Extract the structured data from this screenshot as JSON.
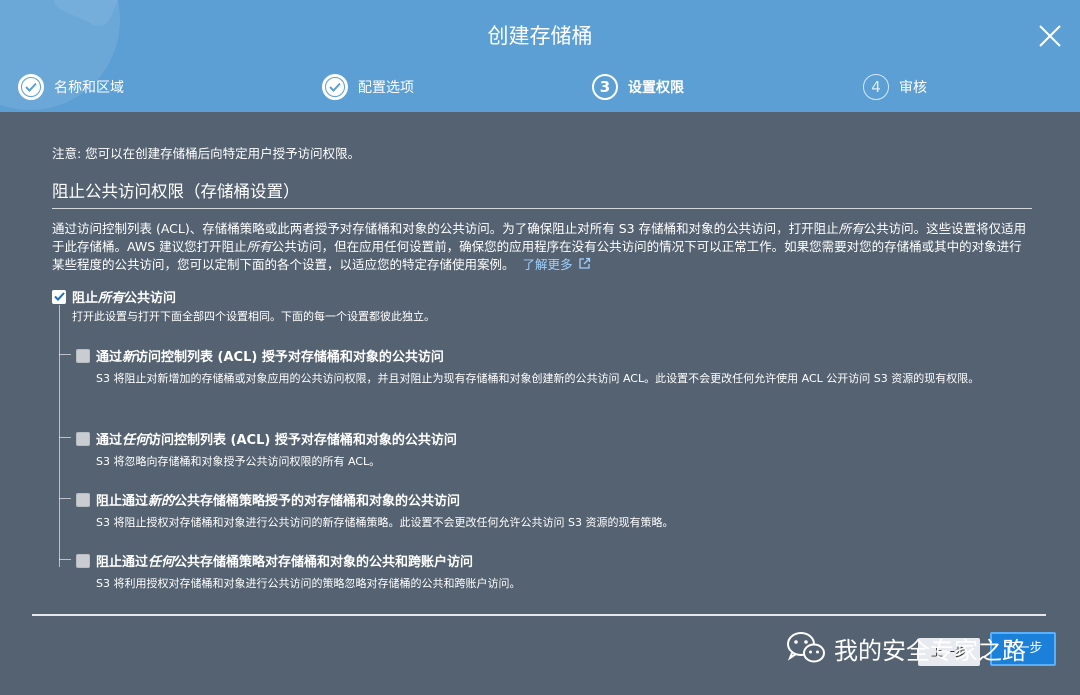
{
  "dialog": {
    "title": "创建存储桶",
    "close_icon": "close-icon"
  },
  "steps": [
    {
      "label": "名称和区域",
      "state": "done"
    },
    {
      "label": "配置选项",
      "state": "done"
    },
    {
      "number": "3",
      "label": "设置权限",
      "state": "current"
    },
    {
      "number": "4",
      "label": "审核",
      "state": "todo"
    }
  ],
  "notice": "注意: 您可以在创建存储桶后向特定用户授予访问权限。",
  "section": {
    "title": "阻止公共访问权限（存储桶设置）",
    "desc_part1": "通过访问控制列表 (ACL)、存储桶策略或此两者授予对存储桶和对象的公共访问。为了确保阻止对所有 S3 存储桶和对象的公共访问，打开阻止",
    "desc_em1": "所有",
    "desc_part2": "公共访问。这些设置将仅适用于此存储桶。AWS 建议您打开阻止",
    "desc_em2": "所有",
    "desc_part3": "公共访问，但在应用任何设置前，确保您的应用程序在没有公共访问的情况下可以正常工作。如果您需要对您的存储桶或其中的对象进行某些程度的公共访问，您可以定制下面的各个设置，以适应您的特定存储使用案例。",
    "learn_more": "了解更多",
    "external_link_icon": "external-link-icon"
  },
  "master_option": {
    "title_a": "阻止",
    "title_em": "所有",
    "title_b": "公共访问",
    "checked": true,
    "subtitle": "打开此设置与打开下面全部四个设置相同。下面的每一个设置都彼此独立。"
  },
  "options": [
    {
      "title_a": "通过",
      "title_em": "新",
      "title_b": "访问控制列表 (ACL) 授予对存储桶和对象的公共访问",
      "desc": "S3 将阻止对新增加的存储桶或对象应用的公共访问权限，并且对阻止为现有存储桶和对象创建新的公共访问 ACL。此设置不会更改任何允许使用 ACL 公开访问 S3 资源的现有权限。"
    },
    {
      "title_a": "通过",
      "title_em": "任何",
      "title_b": "访问控制列表 (ACL) 授予对存储桶和对象的公共访问",
      "desc": "S3 将忽略向存储桶和对象授予公共访问权限的所有 ACL。"
    },
    {
      "title_a": "阻止通过",
      "title_em": "新的",
      "title_b": "公共存储桶策略授予的对存储桶和对象的公共访问",
      "desc": "S3 将阻止授权对存储桶和对象进行公共访问的新存储桶策略。此设置不会更改任何允许公共访问 S3 资源的现有策略。"
    },
    {
      "title_a": "阻止通过",
      "title_em": "任何",
      "title_b": "公共存储桶策略对存储桶和对象的公共和跨账户访问",
      "desc": "S3 将利用授权对存储桶和对象进行公共访问的策略忽略对存储桶的公共和跨账户访问。"
    }
  ],
  "footer": {
    "prev_label": "上一步",
    "next_label": "下一步"
  },
  "watermark": {
    "text": "我的安全专家之路",
    "icon": "wechat-icon"
  },
  "colors": {
    "header_bg": "#5b9fd4",
    "body_bg": "#556271",
    "link": "#9fd0ff",
    "primary_button": "#1a80d9"
  }
}
